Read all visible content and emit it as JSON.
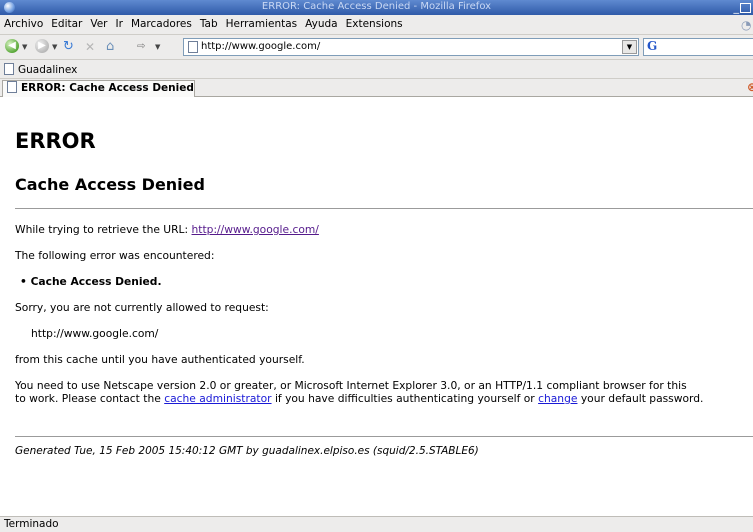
{
  "window": {
    "title": "ERROR: Cache Access Denied - Mozilla Firefox",
    "minimize": "_"
  },
  "menu": [
    "Archivo",
    "Editar",
    "Ver",
    "Ir",
    "Marcadores",
    "Tab",
    "Herramientas",
    "Ayuda",
    "Extensions"
  ],
  "nav": {
    "url": "http://www.google.com/",
    "search_engine": "G"
  },
  "bookmarks": [
    {
      "label": "Guadalinex"
    }
  ],
  "tab": {
    "label": "ERROR: Cache Access Denied"
  },
  "page": {
    "heading": "ERROR",
    "subheading": "Cache Access Denied",
    "retrieve_prefix": "While trying to retrieve the URL: ",
    "retrieve_link": "http://www.google.com/",
    "error_intro": "The following error was encountered:",
    "error_item": "Cache Access Denied.",
    "sorry": "Sorry, you are not currently allowed to request:",
    "requested_url": "http://www.google.com/",
    "from_cache": "from this cache until you have authenticated yourself.",
    "netscape_line": "You need to use Netscape version 2.0 or greater, or Microsoft Internet Explorer 3.0, or an HTTP/1.1 compliant browser for this",
    "contact_prefix": "to work. Please contact the ",
    "cache_admin_link": "cache administrator",
    "contact_middle": " if you have difficulties authenticating yourself or ",
    "change_link": "change",
    "contact_suffix": " your default password.",
    "generated": "Generated Tue, 15 Feb 2005 15:40:12 GMT by guadalinex.elpiso.es (squid/2.5.STABLE6)"
  },
  "status": {
    "text": "Terminado"
  }
}
